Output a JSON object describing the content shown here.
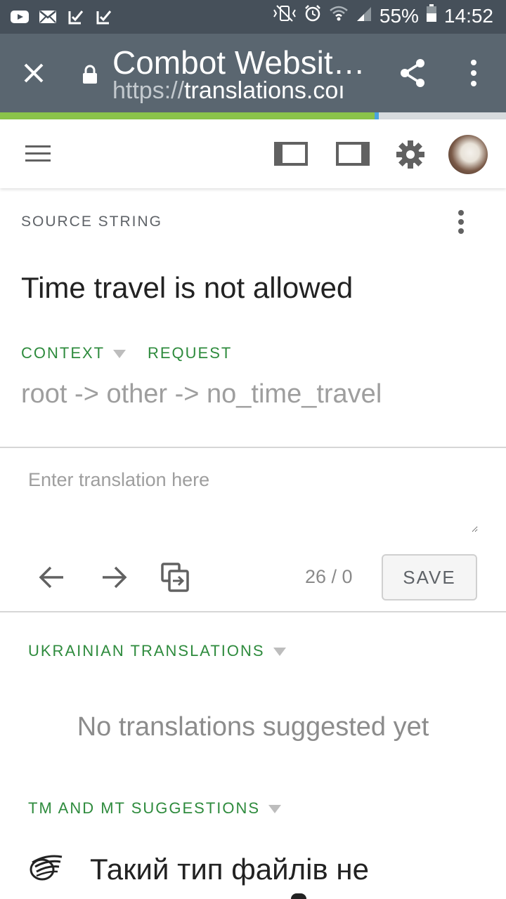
{
  "status_bar": {
    "battery_percent": "55%",
    "time": "14:52",
    "left_icons": [
      "youtube-icon",
      "mail-icon",
      "check-icon",
      "check-icon"
    ],
    "right_icons": [
      "vibrate-icon",
      "alarm-icon",
      "wifi-icon",
      "signal-icon",
      "battery-icon"
    ]
  },
  "browser": {
    "page_title": "Combot Websit…",
    "url_scheme": "https://",
    "url_host": "translations.coı",
    "page_load_progress": 0.74
  },
  "source": {
    "section_label": "SOURCE STRING",
    "text": "Time travel is not allowed",
    "context_label": "CONTEXT",
    "request_label": "REQUEST",
    "context_path": "root -> other -> no_time_travel"
  },
  "editor": {
    "placeholder": "Enter translation here",
    "value": "",
    "counter": "26 / 0",
    "save_label": "SAVE"
  },
  "ukrainian": {
    "header": "UKRAINIAN TRANSLATIONS",
    "empty_message": "No translations suggested yet"
  },
  "suggestions": {
    "header": "TM AND MT SUGGESTIONS",
    "first_text": "Такий тип файлів не"
  },
  "colors": {
    "status_bar": "#46505a",
    "chrome": "#5a6670",
    "progress": "#8bc34a",
    "accent_green": "#2e8b3d"
  }
}
